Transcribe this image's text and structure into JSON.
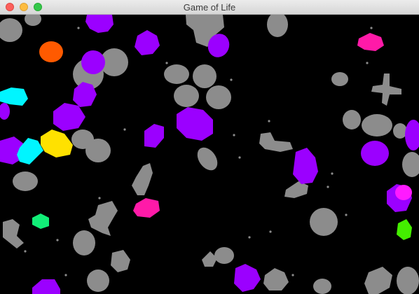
{
  "window": {
    "title": "Game of Life",
    "buttons": [
      "close",
      "minimize",
      "zoom"
    ]
  },
  "game": {
    "background": "#000000",
    "palette": {
      "static": "#8c8c8c",
      "violet": "#9b00ff",
      "magenta": "#ff1aa8",
      "cyan": "#00f5ff",
      "yellow": "#ffe100",
      "orange": "#ff5a00",
      "green": "#11ee77",
      "lime": "#44ee00"
    }
  }
}
